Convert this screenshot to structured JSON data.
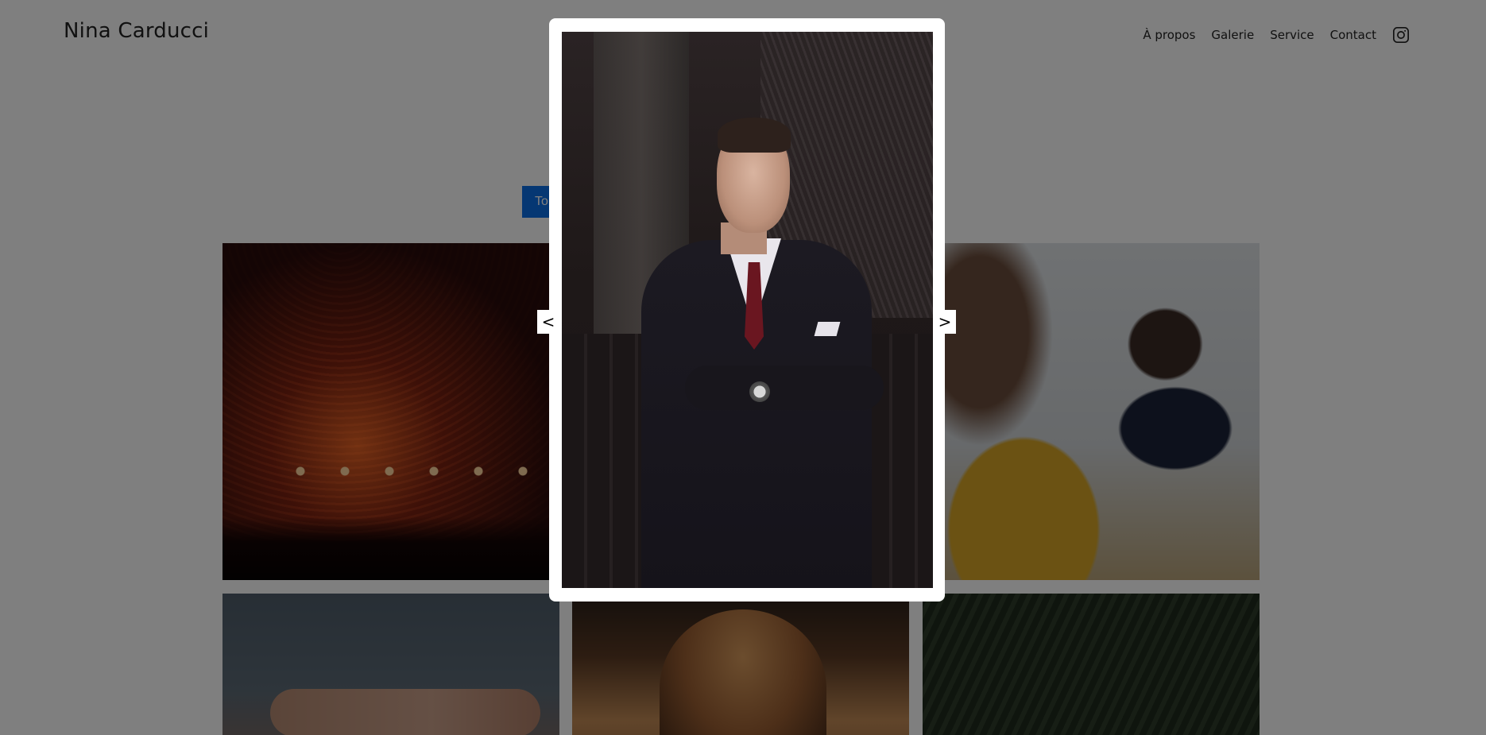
{
  "header": {
    "brand": "Nina Carducci",
    "nav": [
      "À propos",
      "Galerie",
      "Service",
      "Contact"
    ],
    "instagram_icon": "instagram-icon"
  },
  "gallery": {
    "filter_label": "To",
    "tiles": [
      "concert",
      "office-meeting",
      "hands",
      "portrait",
      "palm-trees"
    ]
  },
  "lightbox": {
    "image": "portrait-man-in-suit",
    "prev_label": "<",
    "next_label": ">"
  },
  "colors": {
    "accent": "#0b6fe6",
    "overlay": "rgba(0,0,0,0.5)",
    "modal_bg": "#ffffff"
  }
}
